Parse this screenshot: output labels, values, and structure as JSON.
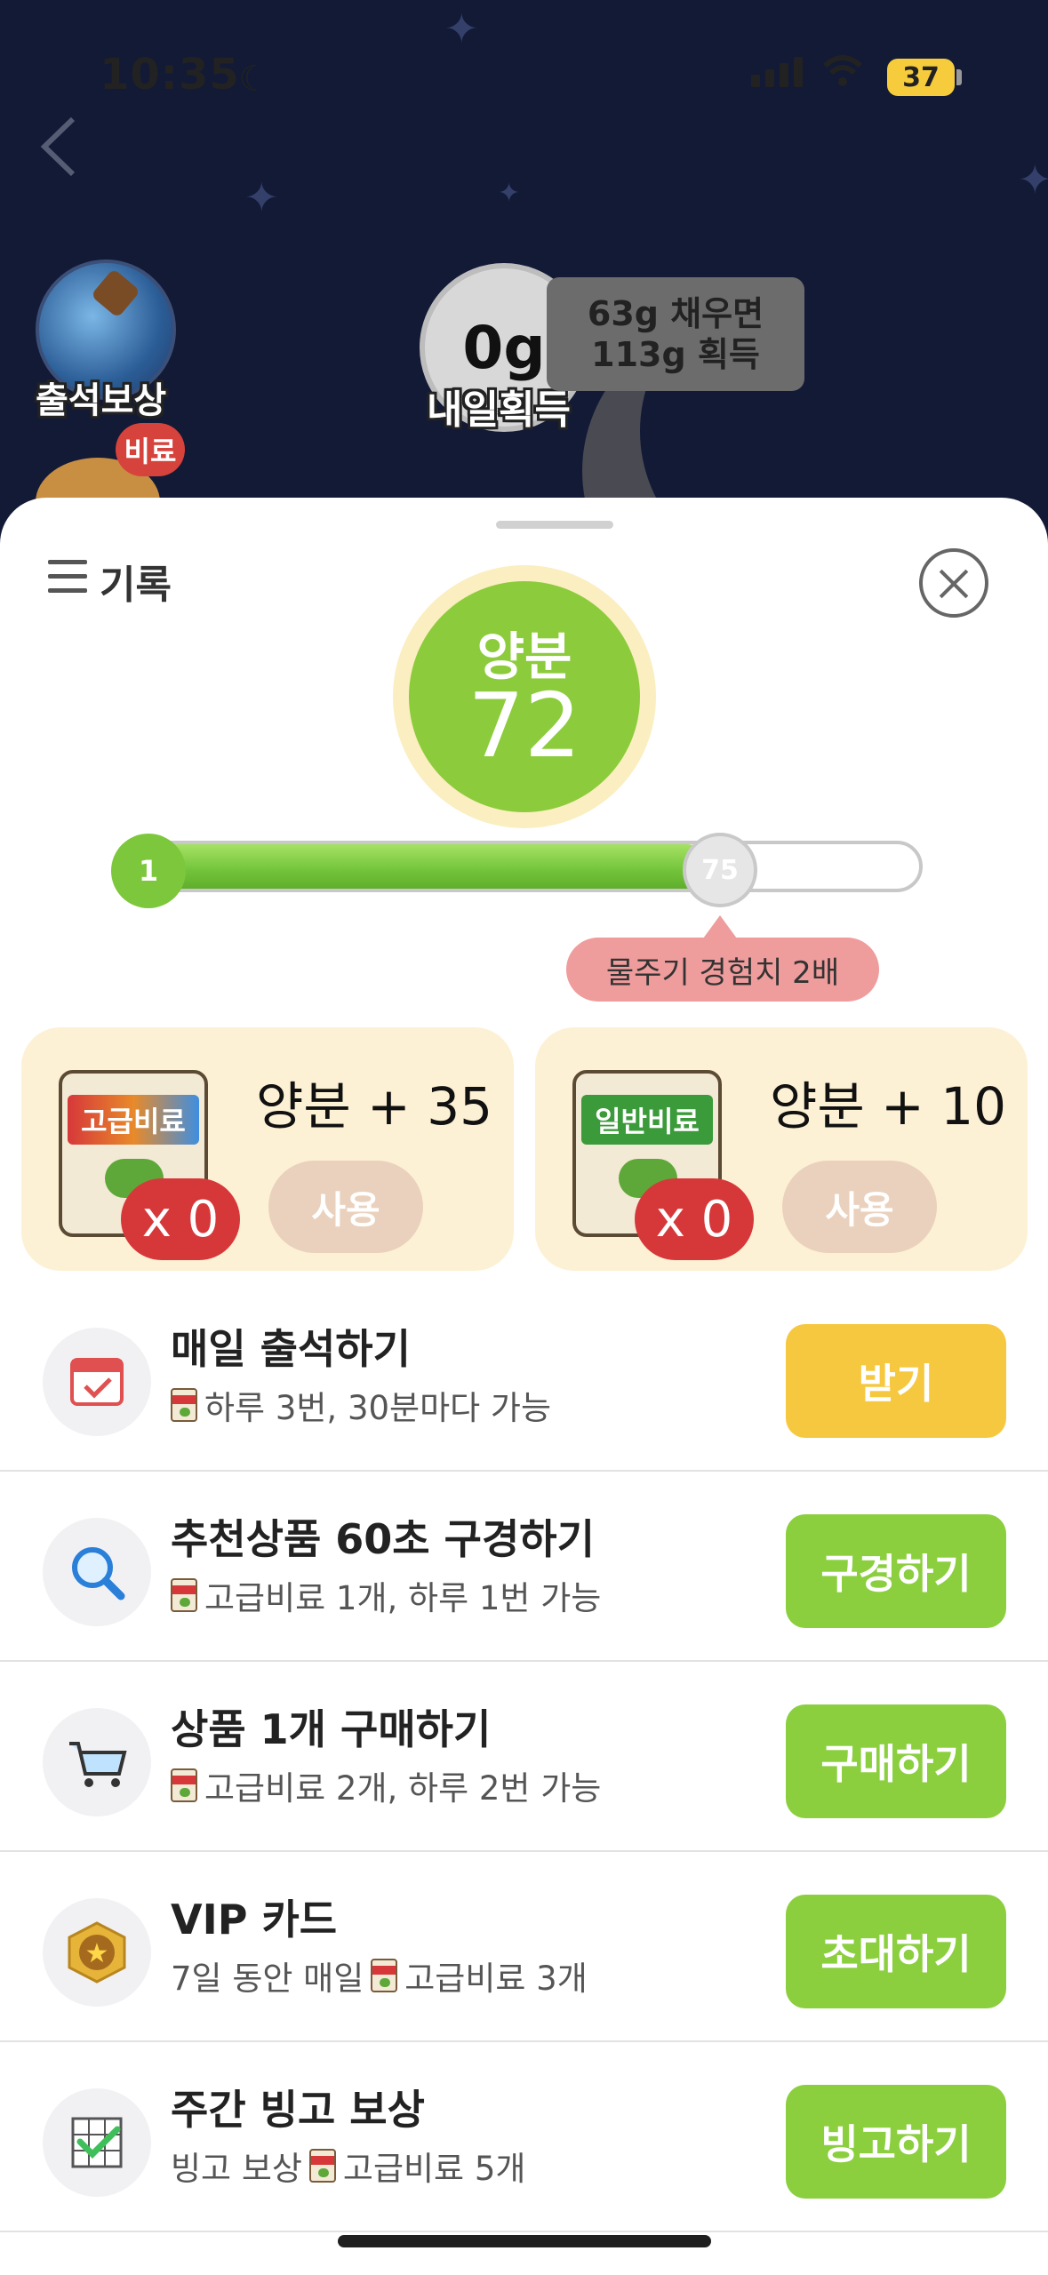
{
  "status_bar": {
    "time": "10:35",
    "battery": "37"
  },
  "header": {
    "attendance_label": "출석보상",
    "fertilizer_badge": "비료",
    "tomorrow_amount": "0g",
    "tomorrow_label": "내일획득",
    "bubble_line1": "63g 채우면",
    "bubble_line2": "113g 획득"
  },
  "sheet": {
    "record_label": "기록",
    "nutrient_label": "양분",
    "nutrient_value": "72",
    "progress": {
      "start_label": "1",
      "end_label": "75",
      "value": 72,
      "max": 75
    },
    "tooltip": "물주기 경험치 2배"
  },
  "fertilizers": [
    {
      "bag_label": "고급비료",
      "title": "양분 + 35",
      "count": "x 0",
      "button": "사용"
    },
    {
      "bag_label": "일반비료",
      "title": "양분 + 10",
      "count": "x 0",
      "button": "사용"
    }
  ],
  "tasks": [
    {
      "title": "매일 출석하기",
      "subtitle": "하루 3번, 30분마다 가능",
      "button": "받기",
      "button_color": "#f6c840",
      "icon": "calendar-icon"
    },
    {
      "title": "추천상품 60초 구경하기",
      "subtitle": "고급비료 1개, 하루 1번 가능",
      "button": "구경하기",
      "button_color": "#8bcf3f",
      "icon": "magnifier-icon"
    },
    {
      "title": "상품 1개 구매하기",
      "subtitle": "고급비료 2개, 하루 2번 가능",
      "button": "구매하기",
      "button_color": "#8bcf3f",
      "icon": "cart-icon"
    },
    {
      "title": "VIP 카드",
      "subtitle_pre": "7일 동안 매일",
      "subtitle": "고급비료 3개",
      "button": "초대하기",
      "button_color": "#8bcf3f",
      "icon": "star-badge-icon"
    },
    {
      "title": "주간 빙고 보상",
      "subtitle_pre": "빙고 보상",
      "subtitle": "고급비료 5개",
      "button": "빙고하기",
      "button_color": "#8bcf3f",
      "icon": "bingo-icon"
    }
  ]
}
